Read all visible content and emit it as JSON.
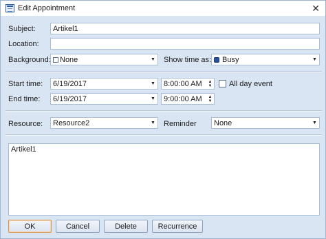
{
  "window": {
    "title": "Edit Appointment",
    "close_glyph": "✕"
  },
  "subject": {
    "label": "Subject:",
    "value": "Artikel1"
  },
  "location": {
    "label": "Location:",
    "value": ""
  },
  "background": {
    "label": "Background:",
    "value": "None"
  },
  "show_time_as": {
    "label": "Show time as:",
    "value": "Busy",
    "color": "#2a4fa0"
  },
  "start": {
    "label": "Start time:",
    "date": "6/19/2017",
    "time": "8:00:00 AM"
  },
  "end": {
    "label": "End time:",
    "date": "6/19/2017",
    "time": "9:00:00 AM"
  },
  "all_day": {
    "label": "All day event",
    "checked": false
  },
  "resource": {
    "label": "Resource:",
    "value": "Resource2"
  },
  "reminder": {
    "label": "Reminder",
    "value": "None"
  },
  "notes": {
    "text": "Artikel1"
  },
  "buttons": {
    "ok": "OK",
    "cancel": "Cancel",
    "delete": "Delete",
    "recurrence": "Recurrence"
  },
  "icons": {
    "dropdown": "chevron-down-icon",
    "spin_up": "spin-up-icon",
    "spin_down": "spin-down-icon"
  }
}
